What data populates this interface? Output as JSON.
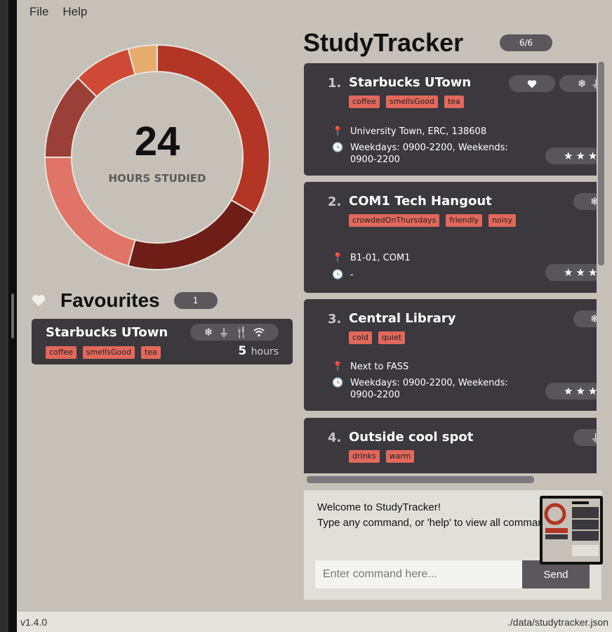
{
  "menu": {
    "file": "File",
    "help": "Help"
  },
  "stats": {
    "hours": "24",
    "label": "HOURS STUDIED"
  },
  "chart_data": {
    "type": "pie",
    "values": [
      8,
      5,
      5,
      3,
      2,
      1
    ],
    "colors": [
      "#b33525",
      "#6e1e17",
      "#e07468",
      "#9a4038",
      "#ce4a37",
      "#e6ad6e"
    ]
  },
  "favourites": {
    "title": "Favourites",
    "count": "1",
    "card": {
      "name": "Starbucks UTown",
      "tags": [
        "coffee",
        "smellsGood",
        "tea"
      ],
      "amenity_icons": [
        "snowflake-icon",
        "plug-icon",
        "utensils-icon",
        "wifi-icon"
      ],
      "hours_value": "5",
      "hours_unit": "hours"
    }
  },
  "app": {
    "title": "StudyTracker",
    "count": "6/6"
  },
  "locations": [
    {
      "index": "1.",
      "name": "Starbucks UTown",
      "tags": [
        "coffee",
        "smellsGood",
        "tea"
      ],
      "address": "University Town, ERC, 138608",
      "hours": "Weekdays: 0900-2200, Weekends: 0900-2200",
      "favourite": true
    },
    {
      "index": "2.",
      "name": "COM1 Tech Hangout",
      "tags": [
        "crowdedOnThursdays",
        "friendly",
        "noisy"
      ],
      "address": "B1-01, COM1",
      "hours": "-"
    },
    {
      "index": "3.",
      "name": "Central Library",
      "tags": [
        "cold",
        "quiet"
      ],
      "address": "Next to FASS",
      "hours": "Weekdays: 0900-2200, Weekends: 0900-2200"
    },
    {
      "index": "4.",
      "name": "Outside cool spot",
      "tags": [
        "drinks",
        "warm"
      ]
    }
  ],
  "result": {
    "line1": "Welcome to StudyTracker!",
    "line2": "Type any command, or 'help' to view all commands"
  },
  "command": {
    "placeholder": "Enter command here...",
    "send": "Send"
  },
  "status": {
    "version": "v1.4.0",
    "path": "./data/studytracker.json"
  }
}
